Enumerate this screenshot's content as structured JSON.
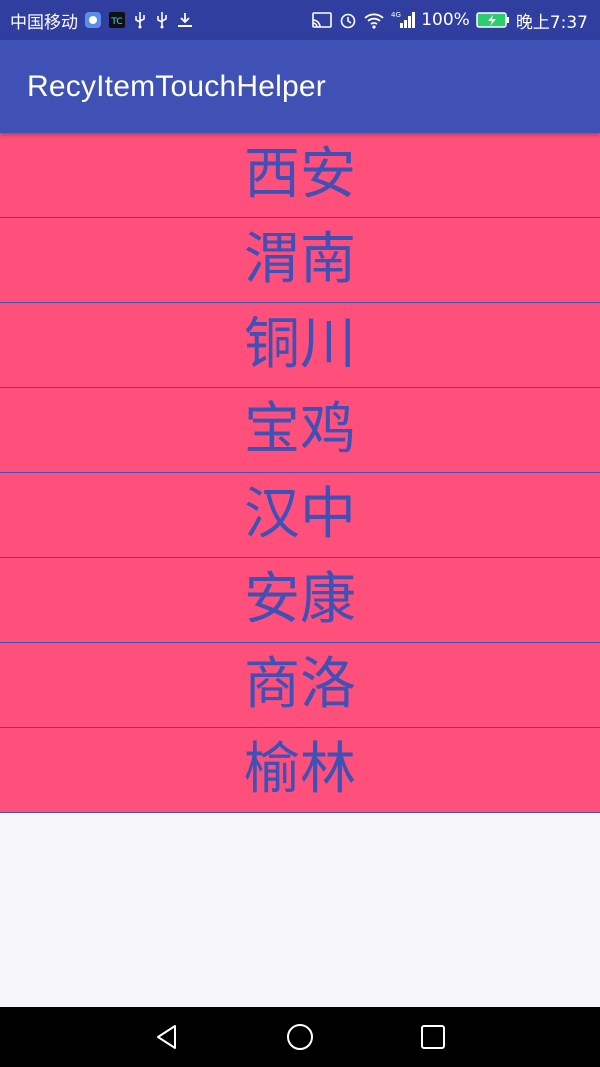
{
  "status_bar": {
    "carrier": "中国移动",
    "network_type": "4G",
    "battery_percent": "100%",
    "time": "晚上7:37",
    "icons": [
      "app-badge-icon",
      "tc-app-icon",
      "usb-icon",
      "usb-icon",
      "download-icon",
      "cast-icon",
      "alarm-icon",
      "wifi-icon",
      "signal-icon",
      "battery-charging-icon"
    ]
  },
  "toolbar": {
    "title": "RecyItemTouchHelper"
  },
  "list": {
    "items": [
      {
        "label": "西安"
      },
      {
        "label": "渭南"
      },
      {
        "label": "铜川"
      },
      {
        "label": "宝鸡"
      },
      {
        "label": "汉中"
      },
      {
        "label": "安康"
      },
      {
        "label": "商洛"
      },
      {
        "label": "榆林"
      }
    ]
  },
  "navigation": {
    "buttons": [
      "back-icon",
      "home-icon",
      "recents-icon"
    ]
  },
  "colors": {
    "status_bar": "#303f9f",
    "toolbar": "#3f51b5",
    "item_background": "#ff4f7b",
    "item_text": "#3f51b5",
    "page_background": "#f6f6f8",
    "nav_bar": "#000000"
  }
}
